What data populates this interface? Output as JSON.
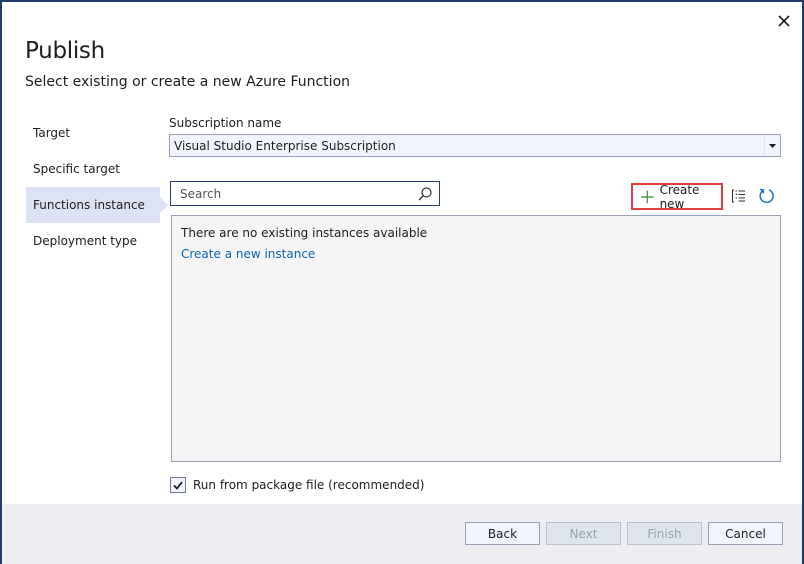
{
  "window": {
    "title": "Publish",
    "subtitle": "Select existing or create a new Azure Function",
    "close_icon": "close-icon"
  },
  "sidebar": {
    "items": [
      {
        "label": "Target",
        "active": false
      },
      {
        "label": "Specific target",
        "active": false
      },
      {
        "label": "Functions instance",
        "active": true
      },
      {
        "label": "Deployment type",
        "active": false
      }
    ]
  },
  "subscription": {
    "label": "Subscription name",
    "value": "Visual Studio Enterprise Subscription",
    "dropdown_icon": "chevron-down-icon"
  },
  "search": {
    "placeholder": "Search",
    "value": "",
    "icon": "search-icon"
  },
  "toolbar": {
    "create_new_label": "Create new",
    "create_new_icon": "plus-icon",
    "view_icon": "list-view-icon",
    "refresh_icon": "refresh-icon",
    "highlight_color": "#e0403c"
  },
  "instances": {
    "empty_message": "There are no existing instances available",
    "create_link": "Create a new instance"
  },
  "options": {
    "run_from_package_label": "Run from package file (recommended)",
    "run_from_package_checked": true
  },
  "footer": {
    "back_label": "Back",
    "next_label": "Next",
    "finish_label": "Finish",
    "cancel_label": "Cancel",
    "next_enabled": false,
    "finish_enabled": false
  },
  "colors": {
    "accent": "#1f3d6e",
    "link": "#0e66b0",
    "selected_bg": "#dde3f5",
    "footer_bg": "#eeeef2"
  }
}
